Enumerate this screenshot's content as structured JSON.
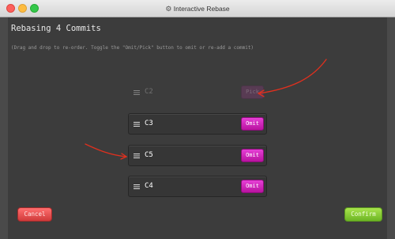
{
  "window": {
    "title": "Interactive Rebase",
    "title_icon": "gear-icon"
  },
  "main": {
    "heading": "Rebasing 4 Commits",
    "instructions": "(Drag and drop to re-order. Toggle the \"Omit/Pick\" button to omit or re-add a commit)"
  },
  "commits": [
    {
      "label": "C2",
      "button": "Pick",
      "omitted": true
    },
    {
      "label": "C3",
      "button": "Omit",
      "omitted": false
    },
    {
      "label": "C5",
      "button": "Omit",
      "omitted": false
    },
    {
      "label": "C4",
      "button": "Omit",
      "omitted": false
    }
  ],
  "footer": {
    "cancel_label": "Cancel",
    "confirm_label": "Confirm"
  },
  "colors": {
    "omit_button": "#d62bc4",
    "cancel_button": "#e84c4c",
    "confirm_button": "#8ccc35",
    "annotation_arrow": "#e0301e"
  }
}
